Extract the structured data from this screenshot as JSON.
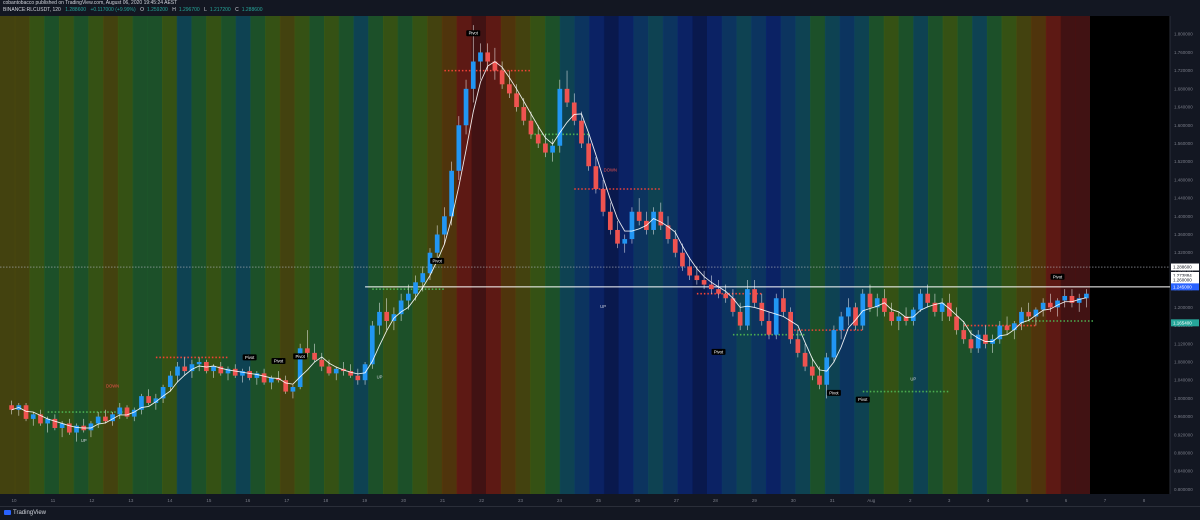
{
  "header": {
    "line1": "cobantobacco published on TradingView.com, August 06, 2020 19:45:24 AEST",
    "symbol": "BINANCE:RLCUSDT, 120",
    "last": "1.288600",
    "change": "+0.117000 (+9.99%)",
    "open_label": "O",
    "open_value": "1.259200",
    "high_label": "H",
    "high_value": "1.296700",
    "low_label": "L",
    "low_value": "1.217200",
    "close_label": "C",
    "close_value": "1.288600"
  },
  "footer": {
    "brand": "TradingView"
  },
  "colors": {
    "background": "#131722",
    "up_candle": "#2196f3",
    "down_candle": "#ef5350",
    "wma_line": "#ffffff",
    "resistance_dots": "#f44336",
    "support_dots": "#4caf50",
    "band_palette": [
      "#4a1210",
      "#6b1a12",
      "#5a3a08",
      "#4c4a0c",
      "#3c5c12",
      "#1e5a2a",
      "#0e4a5a",
      "#0c3a6a",
      "#0a2470",
      "#081a55"
    ]
  },
  "chart_data": {
    "type": "candlestick",
    "y_axis_side": "right",
    "ylim": [
      0.79,
      1.84
    ],
    "y_ticks": [
      {
        "v": 1.8,
        "label": "1.800000"
      },
      {
        "v": 1.76,
        "label": "1.760000"
      },
      {
        "v": 1.72,
        "label": "1.720000"
      },
      {
        "v": 1.68,
        "label": "1.680000"
      },
      {
        "v": 1.64,
        "label": "1.640000"
      },
      {
        "v": 1.6,
        "label": "1.600000"
      },
      {
        "v": 1.56,
        "label": "1.560000"
      },
      {
        "v": 1.52,
        "label": "1.520000"
      },
      {
        "v": 1.48,
        "label": "1.480000"
      },
      {
        "v": 1.44,
        "label": "1.440000"
      },
      {
        "v": 1.4,
        "label": "1.400000"
      },
      {
        "v": 1.36,
        "label": "1.360000"
      },
      {
        "v": 1.32,
        "label": "1.320000"
      },
      {
        "v": 1.28,
        "label": "1.280000"
      },
      {
        "v": 1.24,
        "label": "1.240000"
      },
      {
        "v": 1.2,
        "label": "1.200000"
      },
      {
        "v": 1.16,
        "label": "1.160000"
      },
      {
        "v": 1.12,
        "label": "1.120000"
      },
      {
        "v": 1.08,
        "label": "1.080000"
      },
      {
        "v": 1.04,
        "label": "1.040000"
      },
      {
        "v": 1.0,
        "label": "1.000000"
      },
      {
        "v": 0.96,
        "label": "0.960000"
      },
      {
        "v": 0.92,
        "label": "0.920000"
      },
      {
        "v": 0.88,
        "label": "0.880000"
      },
      {
        "v": 0.84,
        "label": "0.840000"
      },
      {
        "v": 0.8,
        "label": "0.800000"
      }
    ],
    "x_ticks": [
      "10",
      "11",
      "12",
      "13",
      "14",
      "15",
      "16",
      "17",
      "18",
      "19",
      "20",
      "21",
      "22",
      "23",
      "24",
      "25",
      "26",
      "27",
      "28",
      "29",
      "30",
      "31",
      "Aug",
      "2",
      "3",
      "4",
      "5",
      "6",
      "7",
      "8"
    ],
    "price_labels": [
      {
        "v": 1.2886,
        "label": "1.288600",
        "bg": "#ffffff",
        "fg": "#131722"
      },
      {
        "v": 1.27,
        "label": "1.273884",
        "bg": "#ffffff",
        "fg": "#131722"
      },
      {
        "v": 1.26,
        "label": "1.260000",
        "bg": "#ffffff",
        "fg": "#131722"
      },
      {
        "v": 1.245,
        "label": "1.245000",
        "bg": "#2962ff",
        "fg": "#ffffff"
      },
      {
        "v": 1.166,
        "label": "1.165400",
        "bg": "#26a69a",
        "fg": "#ffffff"
      }
    ],
    "horizontal_lines": [
      {
        "v": 1.2886,
        "style": "dotted",
        "color": "#b2b5be"
      },
      {
        "v": 1.245,
        "style": "solid",
        "color": "#ffffff",
        "x_start_index": 49
      }
    ],
    "candles": [
      [
        0.985,
        0.995,
        0.965,
        0.975
      ],
      [
        0.975,
        0.99,
        0.962,
        0.985
      ],
      [
        0.985,
        0.99,
        0.95,
        0.955
      ],
      [
        0.955,
        0.97,
        0.94,
        0.965
      ],
      [
        0.965,
        0.975,
        0.94,
        0.945
      ],
      [
        0.945,
        0.96,
        0.925,
        0.955
      ],
      [
        0.955,
        0.965,
        0.93,
        0.935
      ],
      [
        0.935,
        0.95,
        0.915,
        0.945
      ],
      [
        0.945,
        0.955,
        0.92,
        0.925
      ],
      [
        0.925,
        0.945,
        0.905,
        0.94
      ],
      [
        0.94,
        0.955,
        0.925,
        0.93
      ],
      [
        0.93,
        0.95,
        0.915,
        0.945
      ],
      [
        0.945,
        0.97,
        0.935,
        0.96
      ],
      [
        0.96,
        0.975,
        0.945,
        0.95
      ],
      [
        0.95,
        0.97,
        0.94,
        0.965
      ],
      [
        0.965,
        0.99,
        0.955,
        0.98
      ],
      [
        0.98,
        0.985,
        0.955,
        0.96
      ],
      [
        0.96,
        0.98,
        0.95,
        0.975
      ],
      [
        0.975,
        1.01,
        0.965,
        1.005
      ],
      [
        1.005,
        1.02,
        0.985,
        0.99
      ],
      [
        0.99,
        1.01,
        0.975,
        1.0
      ],
      [
        1.0,
        1.03,
        0.99,
        1.025
      ],
      [
        1.025,
        1.06,
        1.015,
        1.05
      ],
      [
        1.05,
        1.08,
        1.035,
        1.07
      ],
      [
        1.07,
        1.09,
        1.05,
        1.06
      ],
      [
        1.06,
        1.085,
        1.045,
        1.075
      ],
      [
        1.075,
        1.09,
        1.06,
        1.08
      ],
      [
        1.08,
        1.085,
        1.055,
        1.06
      ],
      [
        1.06,
        1.075,
        1.045,
        1.07
      ],
      [
        1.07,
        1.08,
        1.05,
        1.055
      ],
      [
        1.055,
        1.07,
        1.04,
        1.065
      ],
      [
        1.065,
        1.075,
        1.045,
        1.05
      ],
      [
        1.05,
        1.065,
        1.035,
        1.06
      ],
      [
        1.06,
        1.07,
        1.04,
        1.045
      ],
      [
        1.045,
        1.06,
        1.03,
        1.055
      ],
      [
        1.055,
        1.065,
        1.03,
        1.035
      ],
      [
        1.035,
        1.05,
        1.02,
        1.045
      ],
      [
        1.045,
        1.06,
        1.035,
        1.04
      ],
      [
        1.04,
        1.05,
        1.01,
        1.015
      ],
      [
        1.015,
        1.03,
        1.0,
        1.025
      ],
      [
        1.025,
        1.12,
        1.02,
        1.11
      ],
      [
        1.11,
        1.15,
        1.09,
        1.1
      ],
      [
        1.1,
        1.12,
        1.08,
        1.085
      ],
      [
        1.085,
        1.1,
        1.06,
        1.07
      ],
      [
        1.07,
        1.085,
        1.05,
        1.055
      ],
      [
        1.055,
        1.07,
        1.04,
        1.065
      ],
      [
        1.065,
        1.08,
        1.05,
        1.06
      ],
      [
        1.06,
        1.075,
        1.045,
        1.05
      ],
      [
        1.05,
        1.065,
        1.03,
        1.04
      ],
      [
        1.04,
        1.08,
        1.03,
        1.075
      ],
      [
        1.075,
        1.17,
        1.065,
        1.16
      ],
      [
        1.16,
        1.21,
        1.14,
        1.19
      ],
      [
        1.19,
        1.22,
        1.15,
        1.17
      ],
      [
        1.17,
        1.2,
        1.15,
        1.185
      ],
      [
        1.185,
        1.23,
        1.17,
        1.215
      ],
      [
        1.215,
        1.25,
        1.195,
        1.23
      ],
      [
        1.23,
        1.27,
        1.215,
        1.255
      ],
      [
        1.255,
        1.29,
        1.235,
        1.275
      ],
      [
        1.275,
        1.33,
        1.26,
        1.32
      ],
      [
        1.32,
        1.38,
        1.3,
        1.36
      ],
      [
        1.36,
        1.42,
        1.34,
        1.4
      ],
      [
        1.4,
        1.52,
        1.38,
        1.5
      ],
      [
        1.5,
        1.62,
        1.48,
        1.6
      ],
      [
        1.6,
        1.7,
        1.58,
        1.68
      ],
      [
        1.68,
        1.82,
        1.65,
        1.74
      ],
      [
        1.74,
        1.78,
        1.7,
        1.76
      ],
      [
        1.76,
        1.78,
        1.72,
        1.74
      ],
      [
        1.74,
        1.77,
        1.7,
        1.72
      ],
      [
        1.72,
        1.74,
        1.68,
        1.69
      ],
      [
        1.69,
        1.72,
        1.66,
        1.67
      ],
      [
        1.67,
        1.69,
        1.63,
        1.64
      ],
      [
        1.64,
        1.66,
        1.6,
        1.61
      ],
      [
        1.61,
        1.63,
        1.57,
        1.58
      ],
      [
        1.58,
        1.6,
        1.55,
        1.56
      ],
      [
        1.56,
        1.58,
        1.53,
        1.54
      ],
      [
        1.54,
        1.57,
        1.52,
        1.555
      ],
      [
        1.555,
        1.7,
        1.54,
        1.68
      ],
      [
        1.68,
        1.72,
        1.64,
        1.65
      ],
      [
        1.65,
        1.67,
        1.6,
        1.61
      ],
      [
        1.61,
        1.63,
        1.55,
        1.56
      ],
      [
        1.56,
        1.58,
        1.5,
        1.51
      ],
      [
        1.51,
        1.53,
        1.45,
        1.46
      ],
      [
        1.46,
        1.48,
        1.4,
        1.41
      ],
      [
        1.41,
        1.43,
        1.36,
        1.37
      ],
      [
        1.37,
        1.39,
        1.33,
        1.34
      ],
      [
        1.34,
        1.36,
        1.32,
        1.35
      ],
      [
        1.35,
        1.42,
        1.34,
        1.41
      ],
      [
        1.41,
        1.44,
        1.38,
        1.39
      ],
      [
        1.39,
        1.41,
        1.36,
        1.37
      ],
      [
        1.37,
        1.42,
        1.36,
        1.41
      ],
      [
        1.41,
        1.43,
        1.37,
        1.38
      ],
      [
        1.38,
        1.4,
        1.34,
        1.35
      ],
      [
        1.35,
        1.37,
        1.31,
        1.32
      ],
      [
        1.32,
        1.34,
        1.28,
        1.29
      ],
      [
        1.29,
        1.31,
        1.26,
        1.27
      ],
      [
        1.27,
        1.29,
        1.25,
        1.26
      ],
      [
        1.26,
        1.28,
        1.24,
        1.25
      ],
      [
        1.25,
        1.27,
        1.23,
        1.24
      ],
      [
        1.24,
        1.26,
        1.22,
        1.23
      ],
      [
        1.23,
        1.25,
        1.21,
        1.22
      ],
      [
        1.22,
        1.24,
        1.18,
        1.19
      ],
      [
        1.19,
        1.21,
        1.15,
        1.16
      ],
      [
        1.16,
        1.26,
        1.15,
        1.24
      ],
      [
        1.24,
        1.26,
        1.2,
        1.21
      ],
      [
        1.21,
        1.23,
        1.16,
        1.17
      ],
      [
        1.17,
        1.19,
        1.13,
        1.14
      ],
      [
        1.14,
        1.23,
        1.13,
        1.22
      ],
      [
        1.22,
        1.24,
        1.18,
        1.19
      ],
      [
        1.19,
        1.2,
        1.12,
        1.13
      ],
      [
        1.13,
        1.15,
        1.09,
        1.1
      ],
      [
        1.1,
        1.12,
        1.06,
        1.07
      ],
      [
        1.07,
        1.09,
        1.04,
        1.05
      ],
      [
        1.05,
        1.07,
        1.02,
        1.03
      ],
      [
        1.03,
        1.1,
        1.0,
        1.09
      ],
      [
        1.09,
        1.16,
        1.08,
        1.15
      ],
      [
        1.15,
        1.19,
        1.13,
        1.18
      ],
      [
        1.18,
        1.22,
        1.16,
        1.2
      ],
      [
        1.2,
        1.21,
        1.15,
        1.16
      ],
      [
        1.16,
        1.24,
        1.15,
        1.23
      ],
      [
        1.23,
        1.25,
        1.19,
        1.2
      ],
      [
        1.2,
        1.23,
        1.18,
        1.22
      ],
      [
        1.22,
        1.24,
        1.18,
        1.19
      ],
      [
        1.19,
        1.21,
        1.16,
        1.17
      ],
      [
        1.17,
        1.19,
        1.15,
        1.18
      ],
      [
        1.18,
        1.2,
        1.16,
        1.17
      ],
      [
        1.17,
        1.2,
        1.16,
        1.195
      ],
      [
        1.195,
        1.24,
        1.19,
        1.23
      ],
      [
        1.23,
        1.25,
        1.2,
        1.21
      ],
      [
        1.21,
        1.23,
        1.18,
        1.19
      ],
      [
        1.19,
        1.22,
        1.17,
        1.21
      ],
      [
        1.21,
        1.23,
        1.17,
        1.18
      ],
      [
        1.18,
        1.2,
        1.14,
        1.15
      ],
      [
        1.15,
        1.17,
        1.12,
        1.13
      ],
      [
        1.13,
        1.15,
        1.1,
        1.11
      ],
      [
        1.11,
        1.15,
        1.1,
        1.14
      ],
      [
        1.14,
        1.16,
        1.11,
        1.12
      ],
      [
        1.12,
        1.14,
        1.1,
        1.13
      ],
      [
        1.13,
        1.17,
        1.12,
        1.16
      ],
      [
        1.16,
        1.18,
        1.14,
        1.15
      ],
      [
        1.15,
        1.17,
        1.13,
        1.165
      ],
      [
        1.165,
        1.2,
        1.15,
        1.19
      ],
      [
        1.19,
        1.21,
        1.17,
        1.18
      ],
      [
        1.18,
        1.2,
        1.16,
        1.195
      ],
      [
        1.195,
        1.22,
        1.18,
        1.21
      ],
      [
        1.21,
        1.23,
        1.19,
        1.2
      ],
      [
        1.2,
        1.22,
        1.18,
        1.215
      ],
      [
        1.215,
        1.24,
        1.2,
        1.225
      ],
      [
        1.225,
        1.24,
        1.2,
        1.21
      ],
      [
        1.21,
        1.23,
        1.19,
        1.22
      ],
      [
        1.22,
        1.24,
        1.2,
        1.23
      ]
    ],
    "annotations": [
      {
        "i": 10,
        "v": 0.905,
        "text": "UP",
        "color": "#d1d4dc"
      },
      {
        "i": 14,
        "v": 1.025,
        "text": "DOWN",
        "color": "#ef5350"
      },
      {
        "i": 33,
        "v": 1.088,
        "text": "Pivot",
        "color": "#ffffff",
        "boxed": true
      },
      {
        "i": 37,
        "v": 1.08,
        "text": "Pivot",
        "color": "#ffffff",
        "boxed": true
      },
      {
        "i": 40,
        "v": 1.09,
        "text": "Pivot",
        "color": "#ffffff",
        "boxed": true
      },
      {
        "i": 51,
        "v": 1.045,
        "text": "UP",
        "color": "#d1d4dc"
      },
      {
        "i": 64,
        "v": 1.8,
        "text": "Pivot",
        "color": "#ffffff",
        "boxed": true
      },
      {
        "i": 59,
        "v": 1.3,
        "text": "Pivot",
        "color": "#ffffff",
        "boxed": true
      },
      {
        "i": 82,
        "v": 1.2,
        "text": "UP",
        "color": "#d1d4dc"
      },
      {
        "i": 83,
        "v": 1.5,
        "text": "DOWN",
        "color": "#ef5350"
      },
      {
        "i": 98,
        "v": 1.1,
        "text": "Pivot",
        "color": "#ffffff",
        "boxed": true
      },
      {
        "i": 114,
        "v": 1.01,
        "text": "Pivot",
        "color": "#ffffff",
        "boxed": true
      },
      {
        "i": 118,
        "v": 0.995,
        "text": "Pivot",
        "color": "#ffffff",
        "boxed": true
      },
      {
        "i": 125,
        "v": 1.04,
        "text": "UP",
        "color": "#d1d4dc"
      },
      {
        "i": 145,
        "v": 1.265,
        "text": "Pivot",
        "color": "#ffffff",
        "boxed": true
      }
    ],
    "resistance_segments": [
      {
        "i0": 20,
        "i1": 30,
        "v": 1.09
      },
      {
        "i0": 60,
        "i1": 72,
        "v": 1.72
      },
      {
        "i0": 78,
        "i1": 90,
        "v": 1.46
      },
      {
        "i0": 95,
        "i1": 104,
        "v": 1.23
      },
      {
        "i0": 108,
        "i1": 118,
        "v": 1.15
      },
      {
        "i0": 132,
        "i1": 142,
        "v": 1.16
      }
    ],
    "support_segments": [
      {
        "i0": 5,
        "i1": 16,
        "v": 0.97
      },
      {
        "i0": 50,
        "i1": 60,
        "v": 1.24
      },
      {
        "i0": 72,
        "i1": 80,
        "v": 1.58
      },
      {
        "i0": 100,
        "i1": 110,
        "v": 1.14
      },
      {
        "i0": 118,
        "i1": 130,
        "v": 1.015
      },
      {
        "i0": 140,
        "i1": 150,
        "v": 1.17
      }
    ],
    "bands": [
      3,
      3,
      4,
      5,
      4,
      5,
      4,
      3,
      4,
      5,
      5,
      4,
      6,
      5,
      4,
      5,
      6,
      5,
      4,
      3,
      4,
      5,
      4,
      5,
      6,
      5,
      4,
      5,
      4,
      3,
      2,
      1,
      0,
      1,
      2,
      3,
      4,
      5,
      6,
      7,
      8,
      9,
      8,
      7,
      6,
      7,
      8,
      9,
      8,
      7,
      6,
      7,
      8,
      7,
      6,
      5,
      6,
      7,
      6,
      5,
      4,
      5,
      6,
      5,
      4,
      5,
      6,
      5,
      4,
      3,
      2,
      1,
      0,
      0
    ]
  }
}
